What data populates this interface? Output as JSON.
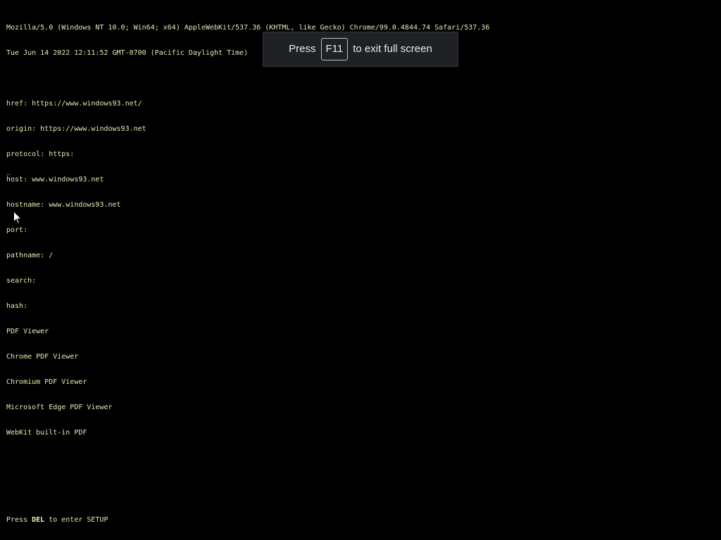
{
  "boot": {
    "user_agent": "Mozilla/5.0 (Windows NT 10.0; Win64; x64) AppleWebKit/537.36 (KHTML, like Gecko) Chrome/99.0.4844.74 Safari/537.36",
    "datetime": "Tue Jun 14 2022 12:11:52 GMT-0700 (Pacific Daylight Time)",
    "location_lines": [
      "href: https://www.windows93.net/",
      "origin: https://www.windows93.net",
      "protocol: https:",
      "host: www.windows93.net",
      "hostname: www.windows93.net",
      "port:",
      "pathname: /",
      "search:",
      "hash:"
    ],
    "plugins": [
      "PDF Viewer",
      "Chrome PDF Viewer",
      "Chromium PDF Viewer",
      "Microsoft Edge PDF Viewer",
      "WebKit built-in PDF"
    ],
    "cursor": "_"
  },
  "footer": {
    "prefix": "Press ",
    "key": "DEL",
    "suffix": " to enter SETUP"
  },
  "fullscreen_banner": {
    "prefix": "Press",
    "key": "F11",
    "suffix": "to exit full screen"
  },
  "colors": {
    "background": "#000000",
    "text": "#e8e9b0",
    "banner_bg": "#202124"
  },
  "icons": {
    "pointer": "mouse-pointer-icon"
  }
}
